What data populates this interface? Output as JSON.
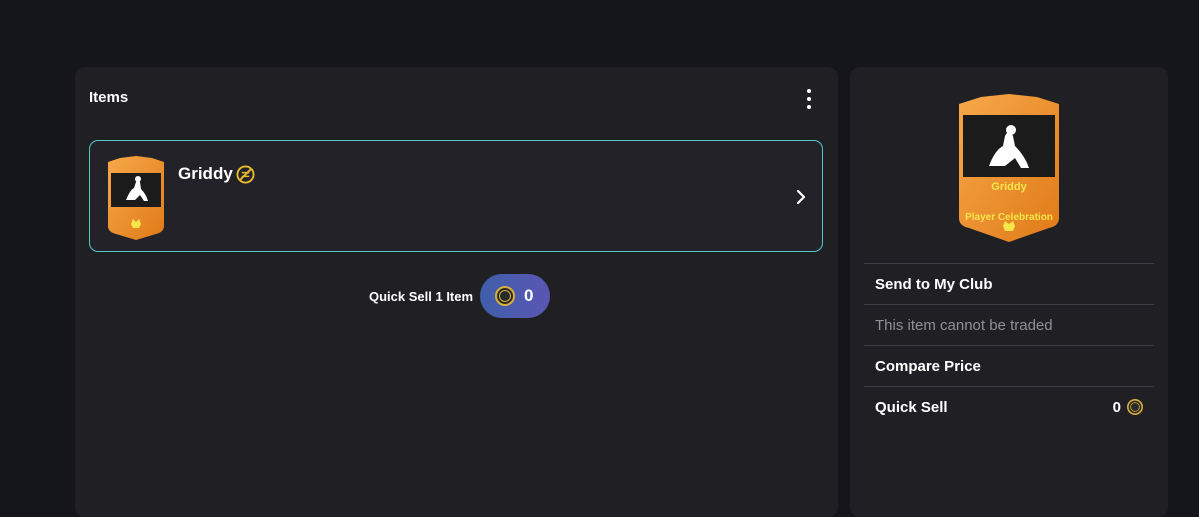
{
  "items_panel": {
    "title": "Items",
    "item": {
      "name": "Griddy",
      "untradeable": true
    },
    "quick_sell": {
      "label": "Quick Sell 1 Item",
      "value": "0"
    }
  },
  "detail_panel": {
    "card": {
      "name": "Griddy",
      "type": "Player Celebration"
    },
    "actions": [
      {
        "label": "Send to My Club",
        "enabled": true
      },
      {
        "label": "This item cannot be traded",
        "enabled": false
      },
      {
        "label": "Compare Price",
        "enabled": true
      },
      {
        "label": "Quick Sell",
        "enabled": true,
        "value": "0"
      }
    ]
  },
  "colors": {
    "card_orange": "#ee8a22",
    "card_orange_light": "#f7a84a",
    "item_border": "#52c9c6",
    "card_text_yellow": "#f7e64a",
    "coin_gold": "#d8b03a"
  }
}
